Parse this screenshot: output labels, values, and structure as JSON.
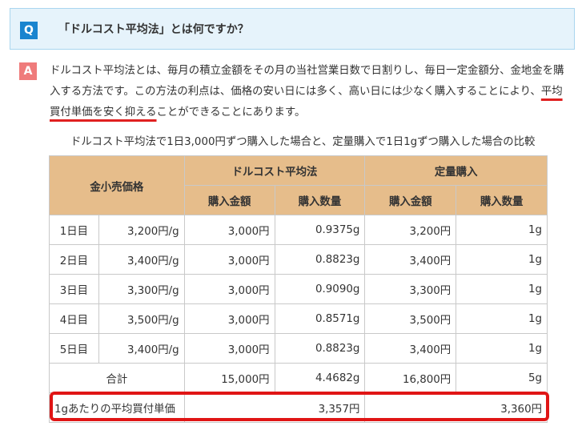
{
  "question": {
    "badge": "Q",
    "text": "「ドルコスト平均法」とは何ですか？"
  },
  "answer": {
    "badge": "A",
    "text_part1": "ドルコスト平均法とは、毎月の積立金額をその月の当社営業日数で日割りし、毎日一定金額分、金地金を購入する方法です。この方法の利点は、価格の安い日には多く、高い日には少なく購入することにより、",
    "text_underlined": "平均買付単価を安く抑える",
    "text_part2": "ことができることにあります。"
  },
  "caption": "ドルコスト平均法で1日3,000円ずつ購入した場合と、定量購入で1日1gずつ購入した場合の比較",
  "table": {
    "header_price": "金小売価格",
    "header_dca": "ドルコスト平均法",
    "header_fixed": "定量購入",
    "sub_amount": "購入金額",
    "sub_qty": "購入数量",
    "rows": [
      {
        "day": "1日目",
        "price": "3,200円/g",
        "dca_amount": "3,000円",
        "dca_qty": "0.9375g",
        "fixed_amount": "3,200円",
        "fixed_qty": "1g"
      },
      {
        "day": "2日目",
        "price": "3,400円/g",
        "dca_amount": "3,000円",
        "dca_qty": "0.8823g",
        "fixed_amount": "3,400円",
        "fixed_qty": "1g"
      },
      {
        "day": "3日目",
        "price": "3,300円/g",
        "dca_amount": "3,000円",
        "dca_qty": "0.9090g",
        "fixed_amount": "3,300円",
        "fixed_qty": "1g"
      },
      {
        "day": "4日目",
        "price": "3,500円/g",
        "dca_amount": "3,000円",
        "dca_qty": "0.8571g",
        "fixed_amount": "3,500円",
        "fixed_qty": "1g"
      },
      {
        "day": "5日目",
        "price": "3,400円/g",
        "dca_amount": "3,000円",
        "dca_qty": "0.8823g",
        "fixed_amount": "3,400円",
        "fixed_qty": "1g"
      }
    ],
    "total": {
      "label": "合計",
      "dca_amount": "15,000円",
      "dca_qty": "4.4682g",
      "fixed_amount": "16,800円",
      "fixed_qty": "5g"
    },
    "avg": {
      "label": "1gあたりの平均買付単価",
      "dca": "3,357円",
      "fixed": "3,360円"
    }
  },
  "colors": {
    "q_badge": "#1a84cf",
    "q_box_bg": "#e6f3fb",
    "a_badge": "#ef7b7b",
    "table_header_bg": "#e6bd8b",
    "highlight_red": "#e01515"
  }
}
